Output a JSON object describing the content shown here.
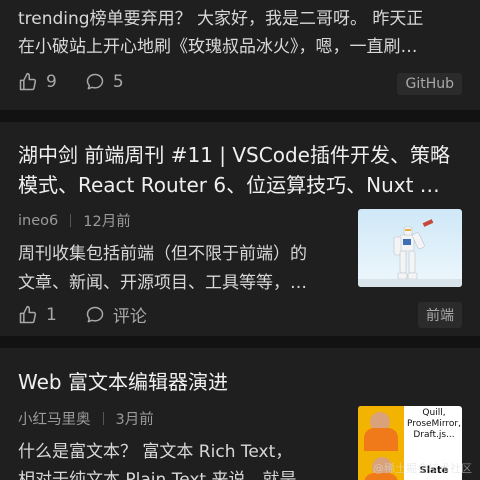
{
  "cards": [
    {
      "excerpt_line1": "trending榜单要弃用？ 大家好，我是二哥呀。 昨天正",
      "excerpt_line2": "在小破站上开心地刷《玫瑰叔品冰火》，嗯，一直刷…",
      "likes": "9",
      "comments": "5",
      "tag": "GitHub"
    },
    {
      "title_line1": "湖中剑 前端周刊 #11 | VSCode插件开发、策略",
      "title_line2": "模式、React Router 6、位运算技巧、Nuxt …",
      "author": "ineo6",
      "time": "12月前",
      "excerpt_line1": "周刊收集包括前端（但不限于前端）的",
      "excerpt_line2": "文章、新闻、开源项目、工具等等，…",
      "likes": "1",
      "comments": "评论",
      "tag": "前端"
    },
    {
      "title_line1": "Web 富文本编辑器演进",
      "author": "小红马里奥",
      "time": "3月前",
      "excerpt_line1": "什么是富文本？ 富文本 Rich Text，",
      "excerpt_line2": "相对于纯文本 Plain Text 来说，就是",
      "meme_top": "Quill, ProseMirror, Draft.js...",
      "meme_bottom": "Slate"
    }
  ],
  "watermark": "@稀土掘金技术社区"
}
